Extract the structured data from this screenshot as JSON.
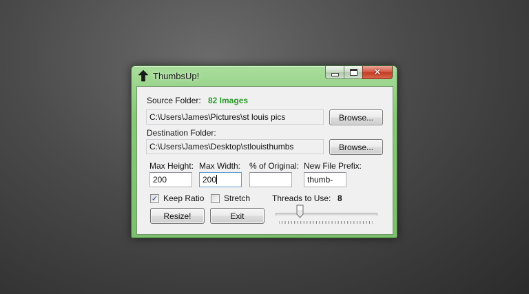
{
  "window": {
    "title": "ThumbsUp!",
    "accent_color": "#7cbf6e",
    "count_color": "#2a9a2a"
  },
  "icons": {
    "app": "up-arrow-icon",
    "minimize": "minimize-icon",
    "maximize": "maximize-icon",
    "close": "close-icon"
  },
  "source": {
    "label": "Source Folder:",
    "count": "82 Images",
    "path": "C:\\Users\\James\\Pictures\\st louis pics",
    "browse_label": "Browse..."
  },
  "destination": {
    "label": "Destination Folder:",
    "path": "C:\\Users\\James\\Desktop\\stlouisthumbs",
    "browse_label": "Browse..."
  },
  "options": {
    "max_height_label": "Max Height:",
    "max_height_value": "200",
    "max_width_label": "Max Width:",
    "max_width_value": "200",
    "percent_label": "% of Original:",
    "percent_value": "",
    "prefix_label": "New File Prefix:",
    "prefix_value": "thumb-"
  },
  "checks": {
    "keep_ratio_label": "Keep Ratio",
    "keep_ratio_checked": true,
    "stretch_label": "Stretch",
    "stretch_checked": false
  },
  "threads": {
    "label": "Threads to Use:",
    "value": "8",
    "min": 1,
    "max": 32
  },
  "actions": {
    "resize_label": "Resize!",
    "exit_label": "Exit"
  }
}
